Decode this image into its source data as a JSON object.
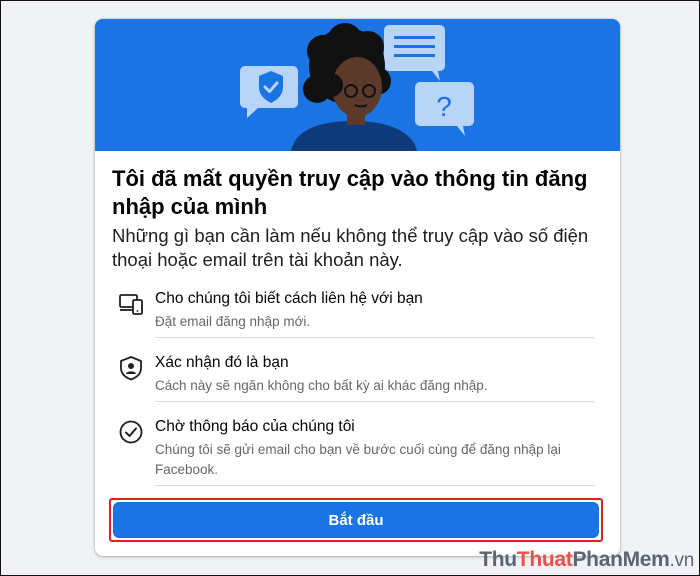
{
  "card": {
    "title": "Tôi đã mất quyền truy cập vào thông tin đăng nhập của mình",
    "subtitle": "Những gì bạn cần làm nếu không thể truy cập vào số điện thoại hoặc email trên tài khoản này.",
    "steps": [
      {
        "icon": "devices-icon",
        "label": "Cho chúng tôi biết cách liên hệ với bạn",
        "description": "Đặt email đăng nhập mới."
      },
      {
        "icon": "shield-user-icon",
        "label": "Xác nhận đó là bạn",
        "description": "Cách này sẽ ngăn không cho bất kỳ ai khác đăng nhập."
      },
      {
        "icon": "check-circle-icon",
        "label": "Chờ thông báo của chúng tôi",
        "description": "Chúng tôi sẽ gửi email cho bạn về bước cuối cùng để đăng nhập lại Facebook."
      }
    ],
    "start_button_label": "Bắt đầu"
  },
  "watermark": {
    "part1": "Thu",
    "part2": "Thuat",
    "part3": "PhanMem",
    "part4": ".vn"
  },
  "colors": {
    "brand_blue": "#1b74e4",
    "highlight_red": "#e02020",
    "hero_light_blue": "#b8d4f7"
  }
}
